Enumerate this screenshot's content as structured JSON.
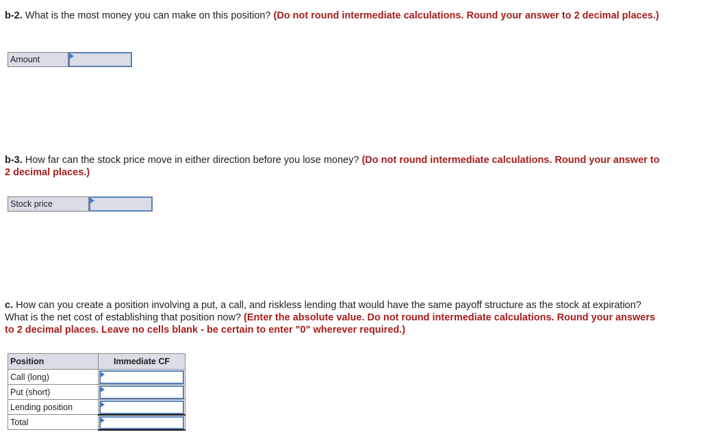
{
  "questions": {
    "b2": {
      "label": "b-2.",
      "text": " What is the most money you can make on this position? ",
      "note": "(Do not round intermediate calculations. Round your answer to 2 decimal places.)",
      "field_label": "Amount",
      "value": ""
    },
    "b3": {
      "label": "b-3.",
      "text": " How far can the stock price move in either direction before you lose money? ",
      "note": "(Do not round intermediate calculations. Round your answer to 2 decimal places.)",
      "field_label": "Stock price",
      "value": ""
    },
    "c": {
      "label": "c.",
      "text": " How can you create a position involving a put, a call, and riskless lending that would have the same payoff structure as the stock at expiration? What is the net cost of establishing that position now? ",
      "note": "(Enter the absolute value. Do not round intermediate calculations. Round your answers to 2 decimal places. Leave no cells blank - be certain to enter \"0\" wherever required.)",
      "table": {
        "headers": [
          "Position",
          "Immediate CF"
        ],
        "rows": [
          {
            "label": "Call (long)",
            "value": ""
          },
          {
            "label": "Put (short)",
            "value": ""
          },
          {
            "label": "Lending position",
            "value": ""
          },
          {
            "label": "Total",
            "value": ""
          }
        ]
      }
    }
  },
  "colors": {
    "note": "#a61d1d",
    "input_border": "#5b7db8",
    "label_bg": "#d9dde6"
  }
}
